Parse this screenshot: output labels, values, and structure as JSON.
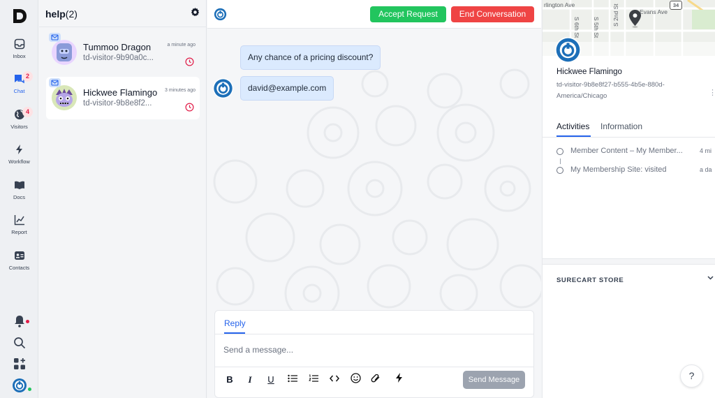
{
  "colors": {
    "accent": "#2563eb",
    "accept": "#22c55e",
    "end": "#ef4444",
    "badge": "#e11d48"
  },
  "rail": {
    "items": [
      {
        "label": "Inbox",
        "icon": "inbox-icon"
      },
      {
        "label": "Chat",
        "icon": "chat-icon",
        "badge": "2"
      },
      {
        "label": "Visitors",
        "icon": "globe-icon",
        "badge": "4"
      },
      {
        "label": "Workflow",
        "icon": "bolt-icon"
      },
      {
        "label": "Docs",
        "icon": "book-icon"
      },
      {
        "label": "Report",
        "icon": "chart-line-icon"
      },
      {
        "label": "Contacts",
        "icon": "contact-card-icon"
      }
    ]
  },
  "conversations": {
    "title": "help",
    "count": "(2)",
    "items": [
      {
        "name": "Tummoo Dragon",
        "visitor_id": "td-visitor-9b90a0c...",
        "time": "a minute ago"
      },
      {
        "name": "Hickwee Flamingo",
        "visitor_id": "td-visitor-9b8e8f2...",
        "time": "3 minutes ago"
      }
    ]
  },
  "chat": {
    "accept_label": "Accept Request",
    "end_label": "End Conversation",
    "messages": [
      {
        "text": "Any chance of a pricing discount?"
      },
      {
        "text": "david@example.com"
      }
    ],
    "composer": {
      "tab_label": "Reply",
      "placeholder": "Send a message...",
      "send_label": "Send Message"
    }
  },
  "profile": {
    "map_labels": [
      "rlington Ave",
      "Evans Ave",
      "S 6th St",
      "S 5th St",
      "S 2nd St",
      "34"
    ],
    "name": "Hickwee Flamingo",
    "visitor_id": "td-visitor-9b8e8f27-b555-4b5e-880d-",
    "timezone": "America/Chicago",
    "tabs": [
      "Activities",
      "Information"
    ],
    "activities": [
      {
        "text": "Member Content – My Member...",
        "time": "4 mi"
      },
      {
        "text": "My Membership Site: visited",
        "time": "a da"
      }
    ],
    "store_heading": "SURECART STORE",
    "help_label": "?"
  }
}
